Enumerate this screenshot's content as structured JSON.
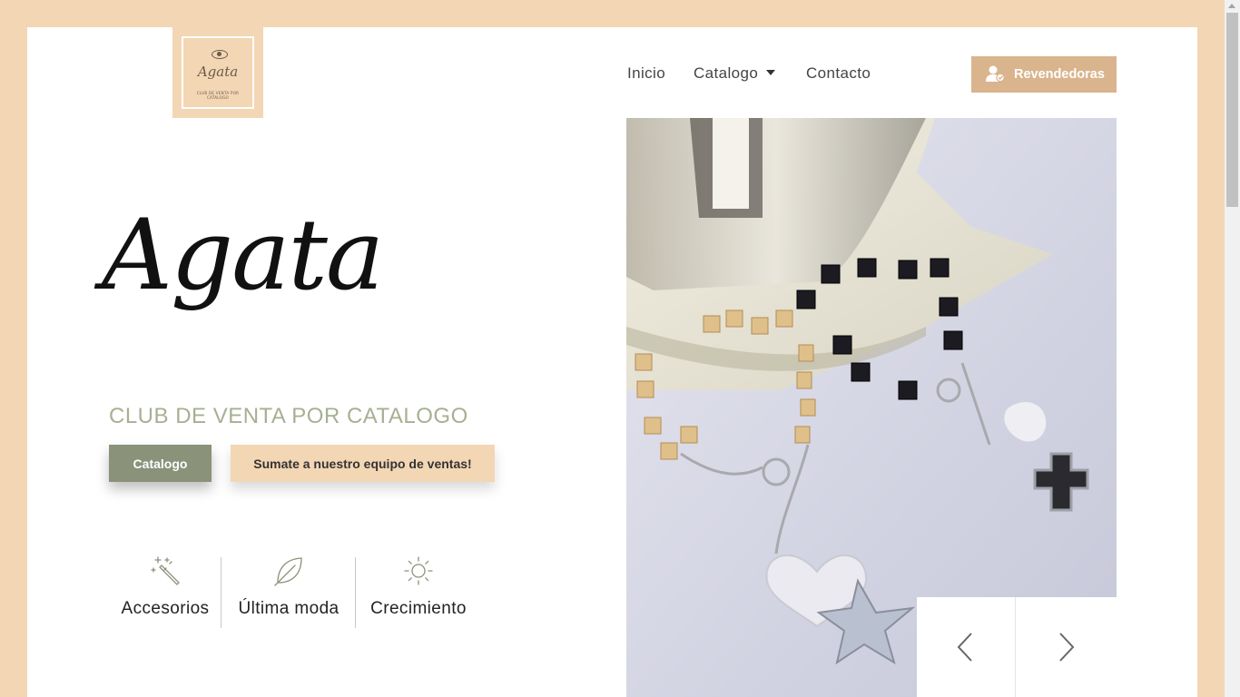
{
  "logo": {
    "name": "Agata",
    "subtitle": "CLUB DE VENTA POR CATALOGO"
  },
  "nav": {
    "items": [
      {
        "label": "Inicio"
      },
      {
        "label": "Catalogo"
      },
      {
        "label": "Contacto"
      }
    ],
    "cta_label": "Revendedoras"
  },
  "hero": {
    "title": "Agata",
    "tagline": "CLUB DE VENTA POR CATALOGO",
    "primary_button": "Catalogo",
    "secondary_button": "Sumate a nuestro equipo de ventas!"
  },
  "features": [
    {
      "label": "Accesorios",
      "icon": "magic-wand-icon"
    },
    {
      "label": "Última moda",
      "icon": "leaf-icon"
    },
    {
      "label": "Crecimiento",
      "icon": "sun-icon"
    }
  ],
  "colors": {
    "page_bg": "#f3d6b4",
    "accent": "#d9b48d",
    "sage": "#8a927a",
    "tagline": "#a6b092"
  },
  "carousel": {
    "prev_icon": "chevron-left-icon",
    "next_icon": "chevron-right-icon"
  }
}
